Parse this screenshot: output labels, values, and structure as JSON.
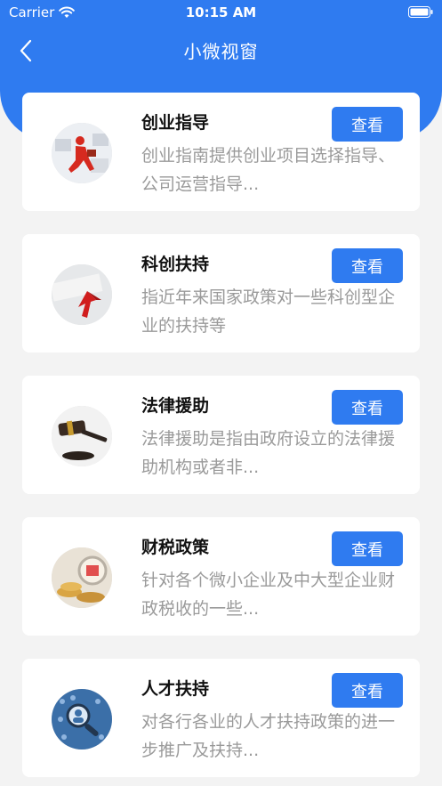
{
  "status_bar": {
    "carrier": "Carrier",
    "time": "10:15 AM"
  },
  "nav": {
    "title": "小微视窗",
    "back_icon": "chevron-left-icon"
  },
  "colors": {
    "primary": "#2f7bf0",
    "background": "#f3f3f3",
    "desc_text": "#9a9a9a"
  },
  "cards": [
    {
      "title": "创业指导",
      "desc": "创业指南提供创业项目选择指导、公司运营指导...",
      "button": "查看"
    },
    {
      "title": "科创扶持",
      "desc": "指近年来国家政策对一些科创型企业的扶持等",
      "button": "查看"
    },
    {
      "title": "法律援助",
      "desc": "法律援助是指由政府设立的法律援助机构或者非...",
      "button": "查看"
    },
    {
      "title": "财税政策",
      "desc": "针对各个微小企业及中大型企业财政税收的一些...",
      "button": "查看"
    },
    {
      "title": "人才扶持",
      "desc": "对各行各业的人才扶持政策的进一步推广及扶持...",
      "button": "查看"
    }
  ]
}
